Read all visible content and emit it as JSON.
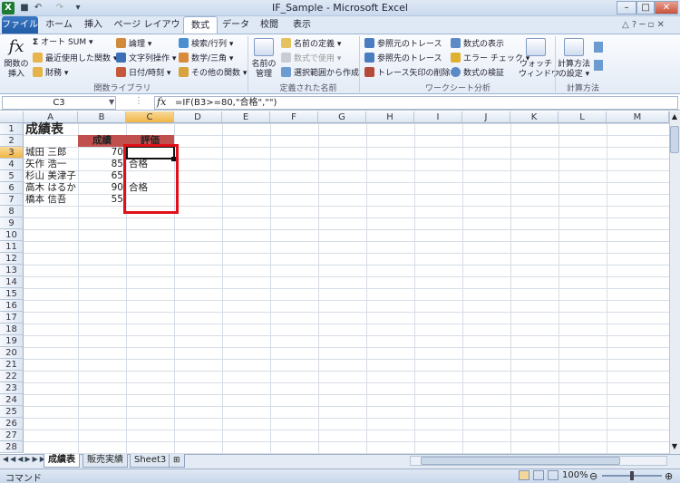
{
  "window": {
    "title": "IF_Sample - Microsoft Excel"
  },
  "tabs": [
    "ファイル",
    "ホーム",
    "挿入",
    "ページ レイアウト",
    "数式",
    "データ",
    "校閲",
    "表示"
  ],
  "active_tab": "数式",
  "ribbon": {
    "insert_function": [
      "関数の",
      "挿入"
    ],
    "autosum": "オート SUM",
    "recent": "最近使用した関数",
    "financial": "財務",
    "logical": "論理",
    "text": "文字列操作",
    "datetime": "日付/時刻",
    "lookup": "検索/行列",
    "math": "数学/三角",
    "more": "その他の関数",
    "group_library": "関数ライブラリ",
    "name_manager": [
      "名前の",
      "管理"
    ],
    "define_name": "名前の定義",
    "use_in_formula": "数式で使用",
    "create_from_sel": "選択範囲から作成",
    "group_names": "定義された名前",
    "trace_prec": "参照元のトレース",
    "trace_dep": "参照先のトレース",
    "remove_arrows": "トレース矢印の削除",
    "show_formulas": "数式の表示",
    "error_check": "エラー チェック",
    "evaluate": "数式の検証",
    "watch": [
      "ウォッチ",
      "ウィンドウ"
    ],
    "group_audit": "ワークシート分析",
    "calc_options": [
      "計算方法",
      "の設定"
    ],
    "group_calc": "計算方法"
  },
  "formula_bar": {
    "name_box": "C3",
    "fx": "fx",
    "formula": "=IF(B3>=80,\"合格\",\"\")"
  },
  "columns": [
    "A",
    "B",
    "C",
    "D",
    "E",
    "F",
    "G",
    "H",
    "I",
    "J",
    "K",
    "L",
    "M"
  ],
  "rows": [
    "1",
    "2",
    "3",
    "4",
    "5",
    "6",
    "7",
    "8",
    "9",
    "10",
    "11",
    "12",
    "13",
    "14",
    "15",
    "16",
    "17",
    "18",
    "19",
    "20",
    "21",
    "22",
    "23",
    "24",
    "25",
    "26",
    "27",
    "28"
  ],
  "sheet": {
    "title": "成績表",
    "headers": {
      "score": "成績",
      "eval": "評価"
    },
    "data": [
      {
        "name": "城田 三郎",
        "score": "70",
        "eval": ""
      },
      {
        "name": "矢作 浩一",
        "score": "85",
        "eval": "合格"
      },
      {
        "name": "杉山 美津子",
        "score": "65",
        "eval": ""
      },
      {
        "name": "高木 はるか",
        "score": "90",
        "eval": "合格"
      },
      {
        "name": "橋本 信吾",
        "score": "55",
        "eval": ""
      }
    ]
  },
  "sheet_tabs": [
    "成績表",
    "販売実績",
    "Sheet3"
  ],
  "status": {
    "mode": "コマンド",
    "zoom": "100%"
  },
  "colors": {
    "header_fill": "#c0504d",
    "highlight": "#e0101a",
    "excel_green": "#1e7b34"
  }
}
